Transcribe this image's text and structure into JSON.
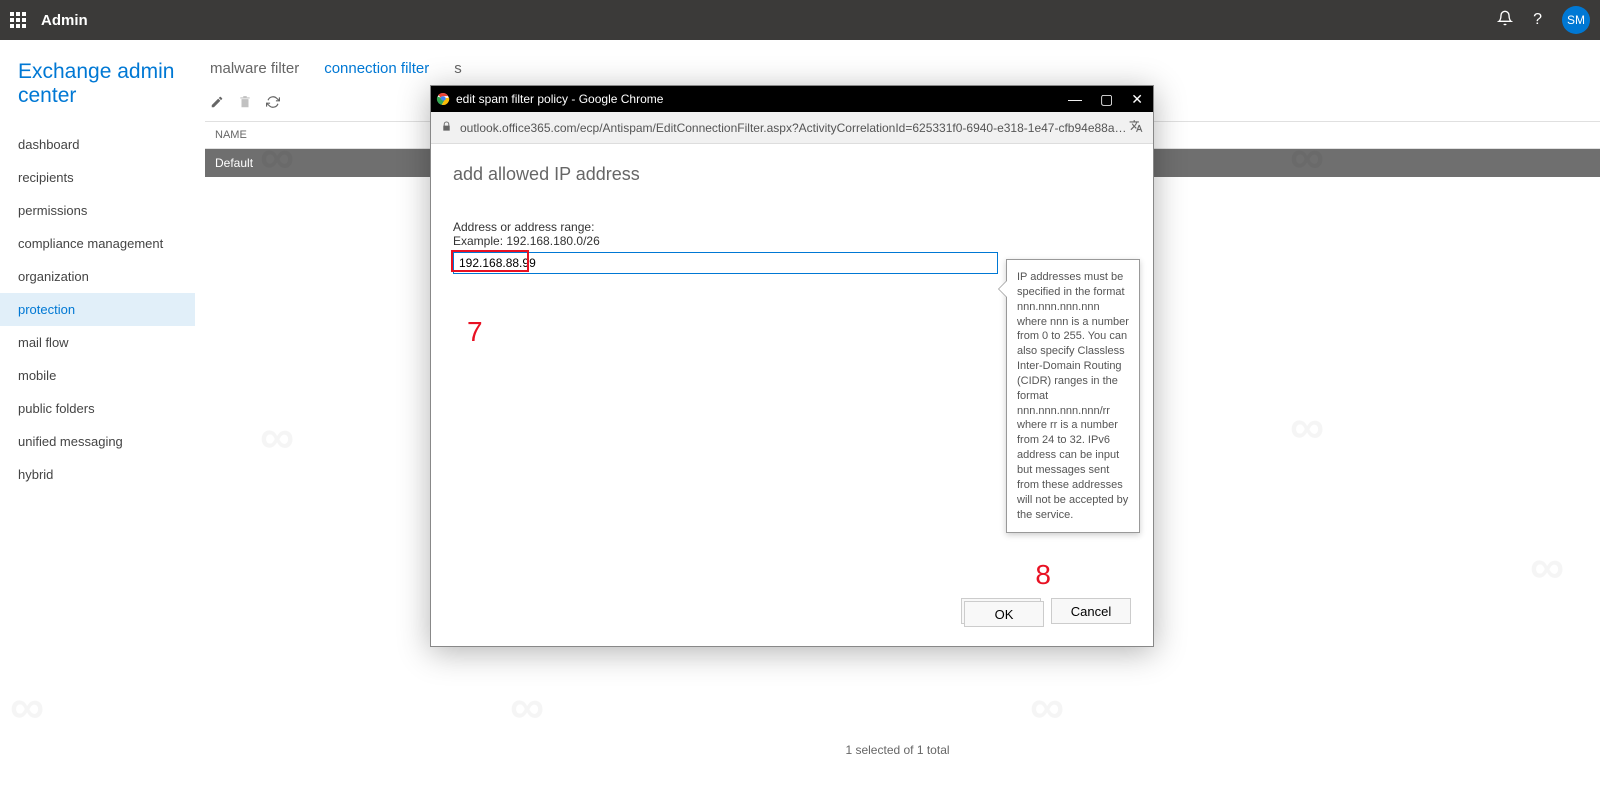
{
  "header": {
    "app_title": "Admin",
    "avatar_initials": "SM"
  },
  "sidebar": {
    "brand": "Exchange admin center",
    "items": [
      {
        "label": "dashboard"
      },
      {
        "label": "recipients"
      },
      {
        "label": "permissions"
      },
      {
        "label": "compliance management"
      },
      {
        "label": "organization"
      },
      {
        "label": "protection",
        "active": true
      },
      {
        "label": "mail flow"
      },
      {
        "label": "mobile"
      },
      {
        "label": "public folders"
      },
      {
        "label": "unified messaging"
      },
      {
        "label": "hybrid"
      }
    ]
  },
  "content": {
    "tabs": [
      {
        "label": "malware filter"
      },
      {
        "label": "connection filter",
        "active": true
      },
      {
        "label": "s"
      }
    ],
    "list": {
      "column_header": "NAME",
      "rows": [
        "Default"
      ]
    },
    "footer": "1 selected of 1 total"
  },
  "popup": {
    "window_title": "edit spam filter policy - Google Chrome",
    "url": "outlook.office365.com/ecp/Antispam/EditConnectionFilter.aspx?ActivityCorrelationId=625331f0-6940-e318-1e47-cfb94e88a554&r...",
    "title": "add allowed IP address",
    "field_label": "Address or address range:",
    "field_example": "Example: 192.168.180.0/26",
    "field_value": "192.168.88.99",
    "tooltip": "IP addresses must be specified in the format nnn.nnn.nnn.nnn where nnn is a number from 0 to 255. You can also specify Classless Inter-Domain Routing (CIDR) ranges in the format nnn.nnn.nnn.nnn/rr where rr is a number from 24 to 32. IPv6 address can be input but messages sent from these addresses will not be accepted by the service.",
    "ok_label": "OK",
    "cancel_label": "Cancel",
    "annotation_7": "7",
    "annotation_8": "8"
  }
}
